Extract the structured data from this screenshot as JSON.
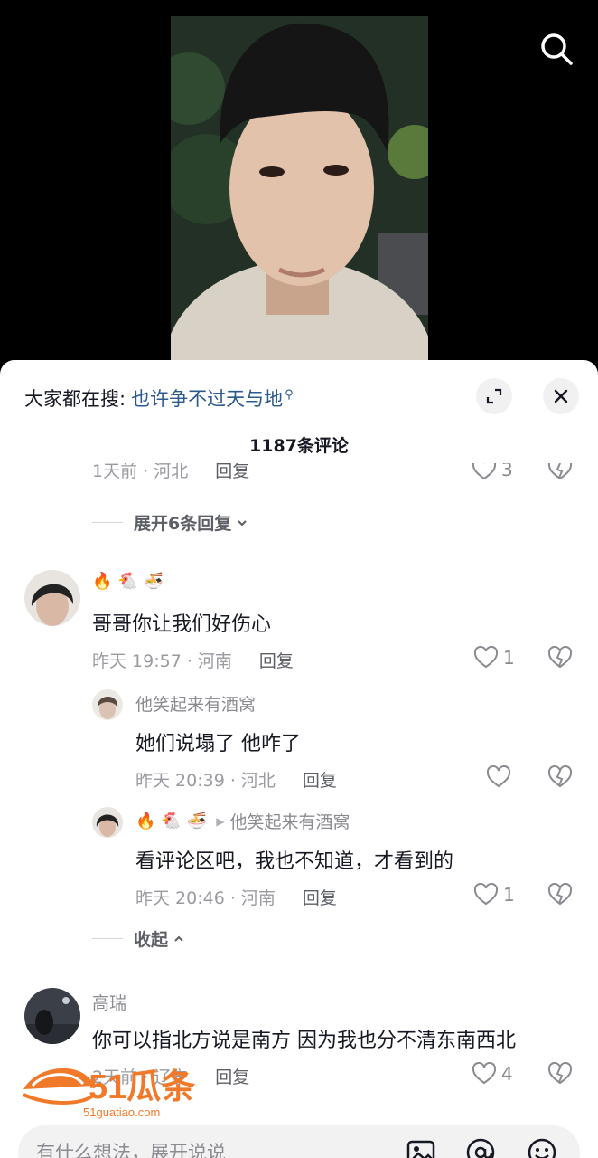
{
  "top": {
    "search_icon": "search-icon"
  },
  "panel": {
    "hot_search_prefix": "大家都在搜:",
    "hot_search_query": "也许争不过天与地",
    "comment_count": "1187条评论",
    "expand_icon": "expand-icon",
    "close_icon": "close-icon"
  },
  "cut_row": {
    "meta": "1天前 · 河北",
    "reply": "回复",
    "likes": "3"
  },
  "expand_replies": "展开6条回复",
  "comments": [
    {
      "name_emojis": [
        "🔥",
        "🐔",
        "🍜"
      ],
      "text": "哥哥你让我们好伤心",
      "meta": "昨天 19:57 · 河南",
      "reply": "回复",
      "likes": "1"
    },
    {
      "name": "他笑起来有酒窝",
      "text": "她们说塌了 他咋了",
      "meta": "昨天 20:39 · 河北",
      "reply": "回复",
      "likes": ""
    },
    {
      "name_emojis": [
        "🔥",
        "🐔",
        "🍜"
      ],
      "reply_to": "他笑起来有酒窝",
      "text": "看评论区吧，我也不知道，才看到的",
      "meta": "昨天 20:46 · 河南",
      "reply": "回复",
      "likes": "1"
    },
    {
      "name": "高瑞",
      "text": "你可以指北方说是南方 因为我也分不清东南西北",
      "meta": "2天前 · 辽宁",
      "reply": "回复",
      "likes": "4"
    }
  ],
  "collapse_replies": "收起",
  "watermark": {
    "brand": "51瓜条",
    "url": "51guatiao.com"
  },
  "input": {
    "placeholder": "有什么想法，展开说说"
  },
  "colors": {
    "link": "#2b5a8c",
    "text": "#161823",
    "meta": "#9a9ba1",
    "watermark": "#f07a2a"
  }
}
